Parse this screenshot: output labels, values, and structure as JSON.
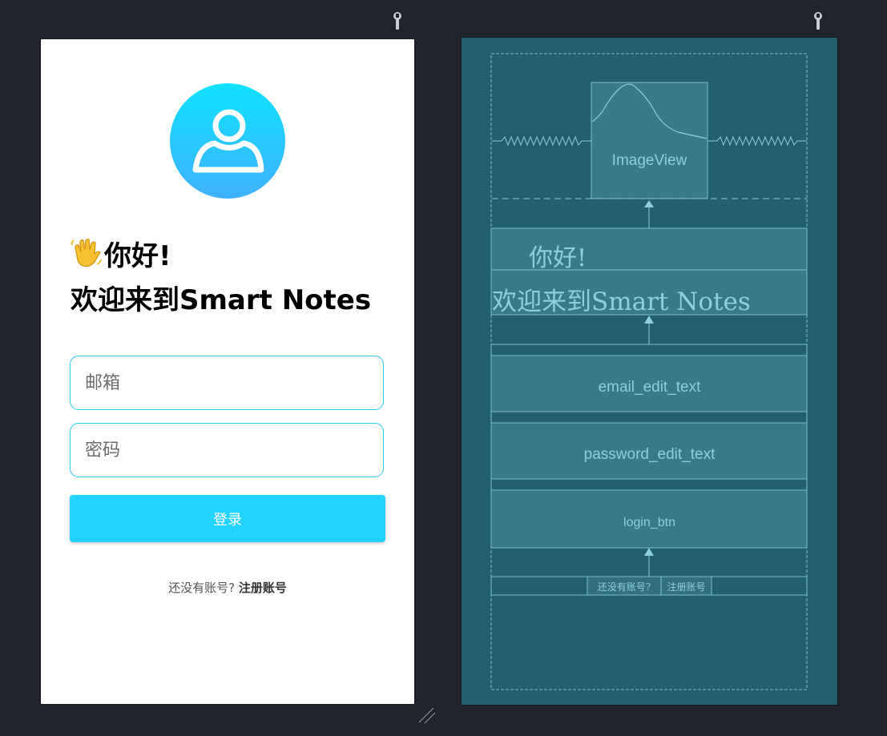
{
  "design": {
    "greeting_line1": "你好!",
    "greeting_line2": "欢迎来到Smart Notes",
    "hand_emoji": "👋",
    "email_placeholder": "邮箱",
    "password_placeholder": "密码",
    "login_label": "登录",
    "signup_prompt": "还没有账号?",
    "signup_link": "注册账号",
    "avatar_icon": "person-icon"
  },
  "blueprint": {
    "image_label": "ImageView",
    "greeting_line1": "你好!",
    "greeting_line2": "欢迎来到Smart Notes",
    "email_label": "email_edit_text",
    "password_label": "password_edit_text",
    "login_label": "login_btn",
    "signup_prompt": "还没有账号?",
    "signup_link": "注册账号"
  },
  "colors": {
    "accent": "#23d3ff",
    "field_border": "#2bc9ef",
    "blueprint_bg": "#245f70",
    "editor_bg": "#1f232b"
  }
}
